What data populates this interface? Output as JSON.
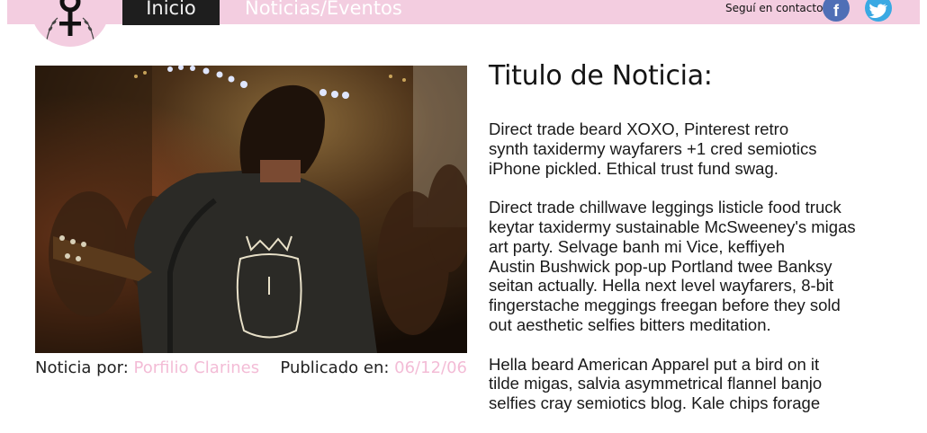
{
  "header": {
    "nav": [
      {
        "label": "Inicio",
        "active": true
      },
      {
        "label": "Noticias/Eventos",
        "active": false
      }
    ],
    "contact_label": "Seguí en contacto:",
    "social": [
      {
        "icon": "facebook-icon",
        "glyph": "f",
        "color": "#4f6fb6"
      },
      {
        "icon": "twitter-icon",
        "glyph": "🐦",
        "color": "#39a9e3"
      }
    ]
  },
  "article": {
    "title": "Titulo de Noticia:",
    "author_label": "Noticia por:",
    "author_name": "Porfilio Clarines",
    "published_label": "Publicado en:",
    "published_date": "06/12/06",
    "paragraphs": [
      "Direct trade beard XOXO, Pinterest retro\nsynth taxidermy wayfarers +1 cred semiotics\niPhone pickled. Ethical trust fund swag.",
      "Direct trade chillwave leggings listicle food truck\nkeytar taxidermy sustainable McSweeney's migas\nart party. Selvage banh mi Vice, keffiyeh\nAustin Bushwick pop-up Portland twee Banksy\nseitan actually. Hella next level wayfarers, 8-bit\nfingerstache meggings freegan before they sold\nout aesthetic selfies bitters meditation.",
      "Hella beard American Apparel put a bird on it\ntilde migas, salvia asymmetrical flannel banjo\nselfies cray semiotics blog. Kale chips forage"
    ]
  },
  "colors": {
    "brand_pink": "#f3cde0",
    "link_pink": "#f3bcd6",
    "nav_active_bg": "#1e1e1e"
  }
}
